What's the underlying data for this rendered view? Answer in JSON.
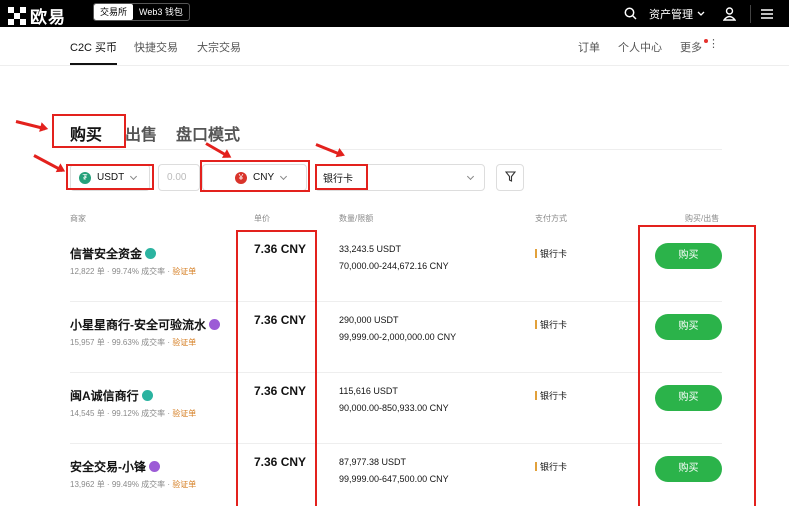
{
  "topbar": {
    "logo_text": "欧易",
    "mode_tabs": [
      "交易所",
      "Web3 钱包"
    ],
    "asset_menu": "资产管理",
    "icons": [
      "search-icon",
      "chevron-down-icon",
      "user-icon",
      "menu-icon"
    ]
  },
  "nav": {
    "left": [
      "C2C 买币",
      "快捷交易",
      "大宗交易"
    ],
    "right": [
      "订单",
      "个人中心",
      "更多"
    ]
  },
  "tabs": [
    "购买",
    "出售",
    "盘口模式"
  ],
  "filters": {
    "crypto": "USDT",
    "amount_placeholder": "0.00",
    "fiat": "CNY",
    "fiat_symbol": "¥",
    "payment": "银行卡"
  },
  "table": {
    "headers": [
      "商家",
      "单价",
      "数量/限额",
      "支付方式",
      "购买/出售"
    ],
    "rows": [
      {
        "merchant": "信誉安全资金",
        "orders": "12,822 单",
        "completion": "99.74% 成交率",
        "verify": "验证单",
        "price": "7.36 CNY",
        "quantity": "33,243.5 USDT",
        "limit": "70,000.00-244,672.16 CNY",
        "payment": "银行卡",
        "action": "购买",
        "badge_color": "#2bb3a0"
      },
      {
        "merchant": "小星星商行-安全可验流水",
        "orders": "15,957 单",
        "completion": "99.63% 成交率",
        "verify": "验证单",
        "price": "7.36 CNY",
        "quantity": "290,000 USDT",
        "limit": "99,999.00-2,000,000.00 CNY",
        "payment": "银行卡",
        "action": "购买",
        "badge_color": "#9c5bd6"
      },
      {
        "merchant": "闽A诚信商行",
        "orders": "14,545 单",
        "completion": "99.12% 成交率",
        "verify": "验证单",
        "price": "7.36 CNY",
        "quantity": "115,616 USDT",
        "limit": "90,000.00-850,933.00 CNY",
        "payment": "银行卡",
        "action": "购买",
        "badge_color": "#2bb3a0"
      },
      {
        "merchant": "安全交易-小锋",
        "orders": "13,962 单",
        "completion": "99.49% 成交率",
        "verify": "验证单",
        "price": "7.36 CNY",
        "quantity": "87,977.38 USDT",
        "limit": "99,999.00-647,500.00 CNY",
        "payment": "银行卡",
        "action": "购买",
        "badge_color": "#9c5bd6"
      }
    ]
  },
  "colors": {
    "buy_green": "#2bb34a",
    "annotation_red": "#e3211d",
    "verify_orange": "#d47b1d",
    "tether_green": "#26a17b",
    "cny_red": "#d9342b"
  }
}
